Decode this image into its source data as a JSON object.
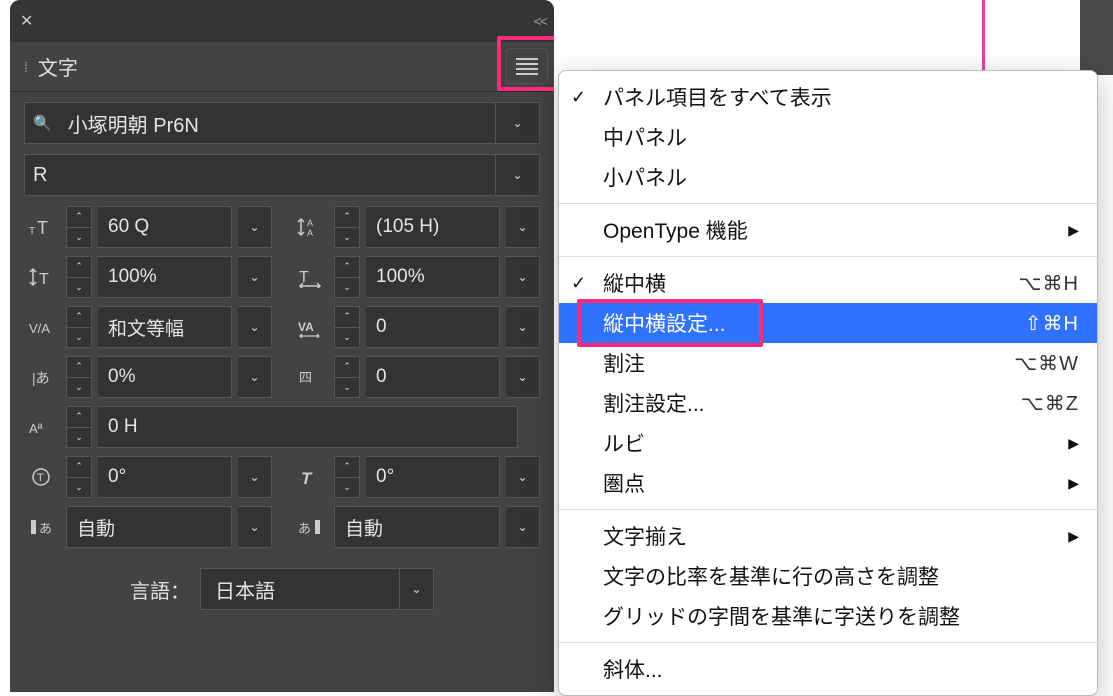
{
  "panel": {
    "tab_title": "文字",
    "font_family": "小塚明朝 Pr6N",
    "font_style": "R",
    "controls": {
      "size": {
        "value": "60 Q"
      },
      "leading": {
        "value": "(105 H)"
      },
      "vscale": {
        "value": "100%"
      },
      "hscale": {
        "value": "100%"
      },
      "kerning": {
        "value": "和文等幅"
      },
      "tracking": {
        "value": "0"
      },
      "tsume": {
        "value": "0%"
      },
      "aki": {
        "value": "0"
      },
      "baseline": {
        "value": "0 H"
      },
      "rotation": {
        "value": "0°"
      },
      "skew": {
        "value": "0°"
      },
      "auto1": {
        "value": "自動"
      },
      "auto2": {
        "value": "自動"
      }
    },
    "language_label": "言語：",
    "language_value": "日本語"
  },
  "menu": {
    "items": [
      {
        "label": "パネル項目をすべて表示",
        "checked": true
      },
      {
        "label": "中パネル"
      },
      {
        "label": "小パネル"
      },
      {
        "sep": true
      },
      {
        "label": "OpenType 機能",
        "submenu": true
      },
      {
        "sep": true
      },
      {
        "label": "縦中横",
        "checked": true,
        "shortcut": "⌥⌘H"
      },
      {
        "label": "縦中横設定...",
        "shortcut": "⇧⌘H",
        "selected": true
      },
      {
        "label": "割注",
        "shortcut": "⌥⌘W"
      },
      {
        "label": "割注設定...",
        "shortcut": "⌥⌘Z"
      },
      {
        "label": "ルビ",
        "submenu": true
      },
      {
        "label": "圏点",
        "submenu": true
      },
      {
        "sep": true
      },
      {
        "label": "文字揃え",
        "submenu": true
      },
      {
        "label": "文字の比率を基準に行の高さを調整"
      },
      {
        "label": "グリッドの字間を基準に字送りを調整"
      },
      {
        "sep": true
      },
      {
        "label": "斜体..."
      }
    ]
  }
}
